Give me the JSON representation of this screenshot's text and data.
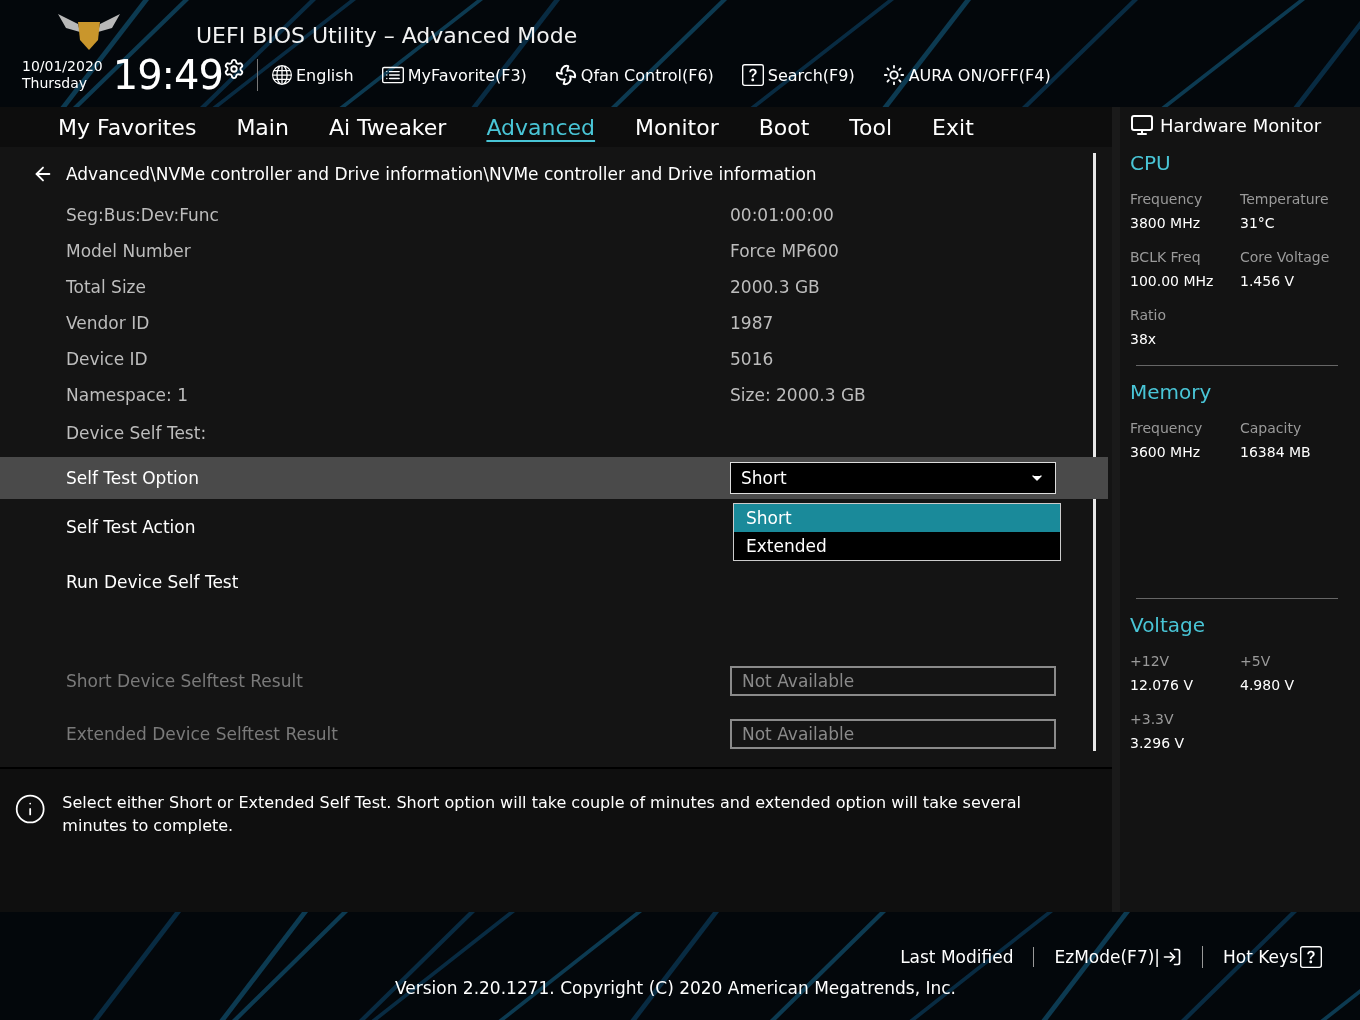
{
  "header": {
    "title": "UEFI BIOS Utility – Advanced Mode",
    "date": "10/01/2020",
    "day": "Thursday",
    "time": "19:49",
    "tools": [
      {
        "label": "English"
      },
      {
        "label": "MyFavorite(F3)"
      },
      {
        "label": "Qfan Control(F6)"
      },
      {
        "label": "Search(F9)"
      },
      {
        "label": "AURA ON/OFF(F4)"
      }
    ]
  },
  "tabs": [
    {
      "label": "My Favorites",
      "selected": false
    },
    {
      "label": "Main",
      "selected": false
    },
    {
      "label": "Ai Tweaker",
      "selected": false
    },
    {
      "label": "Advanced",
      "selected": true
    },
    {
      "label": "Monitor",
      "selected": false
    },
    {
      "label": "Boot",
      "selected": false
    },
    {
      "label": "Tool",
      "selected": false
    },
    {
      "label": "Exit",
      "selected": false
    }
  ],
  "breadcrumb": "Advanced\\NVMe controller and Drive information\\NVMe controller and Drive information",
  "items": [
    {
      "kind": "info",
      "label": "Seg:Bus:Dev:Func",
      "value": "00:01:00:00"
    },
    {
      "kind": "info",
      "label": "Model Number",
      "value": "Force MP600"
    },
    {
      "kind": "info",
      "label": "Total Size",
      "value": "2000.3 GB"
    },
    {
      "kind": "info",
      "label": "Vendor ID",
      "value": "1987"
    },
    {
      "kind": "info",
      "label": "Device ID",
      "value": "5016"
    },
    {
      "kind": "info",
      "label": "Namespace: 1",
      "value": "Size: 2000.3 GB"
    },
    {
      "kind": "heading",
      "label": "Device Self Test:"
    },
    {
      "kind": "select",
      "label": "Self Test Option",
      "value": "Short",
      "highlighted": true,
      "expanded": true,
      "options": [
        {
          "label": "Short",
          "selected": true
        },
        {
          "label": "Extended",
          "selected": false
        }
      ]
    },
    {
      "kind": "action",
      "label": "Self Test Action"
    },
    {
      "kind": "action",
      "label": "Run Device Self Test"
    },
    {
      "kind": "field",
      "label": "Short Device Selftest Result",
      "value": "Not Available",
      "disabled": true
    },
    {
      "kind": "field",
      "label": "Extended Device Selftest Result",
      "value": "Not Available",
      "disabled": true
    }
  ],
  "help": "Select either Short or Extended Self Test. Short option will take couple of minutes and extended option will take several minutes to complete.",
  "monitor": {
    "title": "Hardware Monitor",
    "sections": [
      {
        "title": "CPU",
        "readings": [
          {
            "label": "Frequency",
            "value": "3800 MHz"
          },
          {
            "label": "Temperature",
            "value": "31°C"
          },
          {
            "label": "BCLK Freq",
            "value": "100.00 MHz"
          },
          {
            "label": "Core Voltage",
            "value": "1.456 V"
          },
          {
            "label": "Ratio",
            "value": "38x"
          }
        ]
      },
      {
        "title": "Memory",
        "readings": [
          {
            "label": "Frequency",
            "value": "3600 MHz"
          },
          {
            "label": "Capacity",
            "value": "16384 MB"
          }
        ]
      },
      {
        "title": "Voltage",
        "readings": [
          {
            "label": "+12V",
            "value": "12.076 V"
          },
          {
            "label": "+5V",
            "value": "4.980 V"
          },
          {
            "label": "+3.3V",
            "value": "3.296 V"
          }
        ]
      }
    ]
  },
  "footer": {
    "buttons": [
      {
        "label": "Last Modified"
      },
      {
        "label": "EzMode(F7)|"
      },
      {
        "label": "Hot Keys"
      }
    ],
    "version": "Version 2.20.1271. Copyright (C) 2020 American Megatrends, Inc."
  }
}
